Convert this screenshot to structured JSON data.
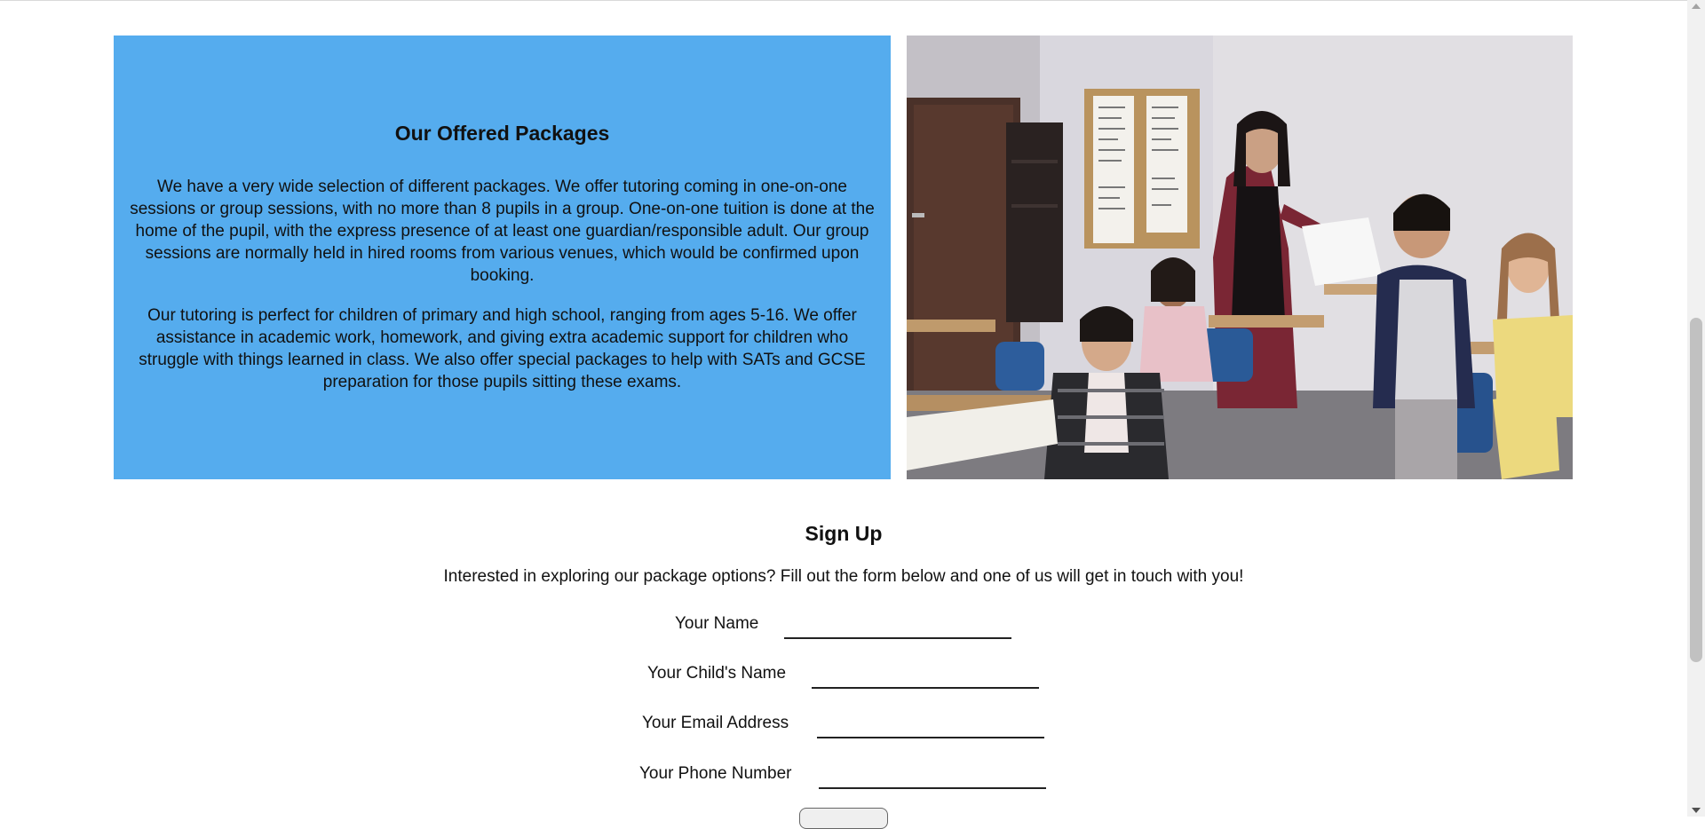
{
  "packages": {
    "title": "Our Offered Packages",
    "paragraph1": "We have a very wide selection of different packages. We offer tutoring coming in one-on-one sessions or group sessions, with no more than 8 pupils in a group. One-on-one tuition is done at the home of the pupil, with the express presence of at least one guardian/responsible adult. Our group sessions are normally held in hired rooms from various venues, which would be confirmed upon booking.",
    "paragraph2": "Our tutoring is perfect for children of primary and high school, ranging from ages 5-16. We offer assistance in academic work, homework, and giving extra academic support for children who struggle with things learned in class. We also offer special packages to help with SATs and GCSE preparation for those pupils sitting these exams.",
    "background_color": "#55acee"
  },
  "photo": {
    "subject": "classroom-tutoring-photo"
  },
  "signup": {
    "title": "Sign Up",
    "intro": "Interested in exploring our package options? Fill out the form below and one of us will get in touch with you!",
    "fields": [
      {
        "label": "Your Name",
        "value": ""
      },
      {
        "label": "Your Child's Name",
        "value": ""
      },
      {
        "label": "Your Email Address",
        "value": ""
      },
      {
        "label": "Your Phone Number",
        "value": ""
      }
    ]
  }
}
